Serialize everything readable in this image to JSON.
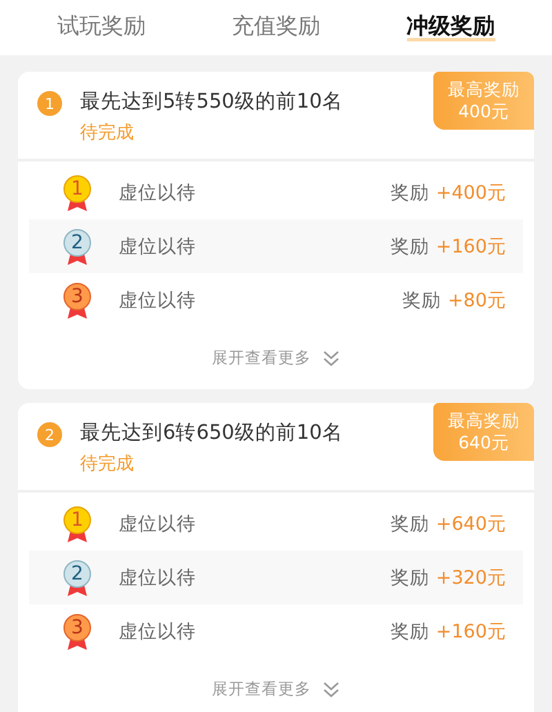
{
  "tabs": [
    {
      "label": "试玩奖励",
      "selected": false
    },
    {
      "label": "充值奖励",
      "selected": false
    },
    {
      "label": "冲级奖励",
      "selected": true
    }
  ],
  "tasks": [
    {
      "index": "1",
      "title": "最先达到5转550级的前10名",
      "status": "待完成",
      "badge_title": "最高奖励",
      "badge_amount": "400元",
      "rows": [
        {
          "rank": "1",
          "kind": "gold",
          "name": "虚位以待",
          "reward_label": "奖励",
          "reward": "+400元"
        },
        {
          "rank": "2",
          "kind": "silver",
          "name": "虚位以待",
          "reward_label": "奖励",
          "reward": "+160元"
        },
        {
          "rank": "3",
          "kind": "bronze",
          "name": "虚位以待",
          "reward_label": "奖励",
          "reward": "+80元"
        }
      ],
      "more": "展开查看更多"
    },
    {
      "index": "2",
      "title": "最先达到6转650级的前10名",
      "status": "待完成",
      "badge_title": "最高奖励",
      "badge_amount": "640元",
      "rows": [
        {
          "rank": "1",
          "kind": "gold",
          "name": "虚位以待",
          "reward_label": "奖励",
          "reward": "+640元"
        },
        {
          "rank": "2",
          "kind": "silver",
          "name": "虚位以待",
          "reward_label": "奖励",
          "reward": "+320元"
        },
        {
          "rank": "3",
          "kind": "bronze",
          "name": "虚位以待",
          "reward_label": "奖励",
          "reward": "+160元"
        }
      ],
      "more": "展开查看更多"
    }
  ]
}
